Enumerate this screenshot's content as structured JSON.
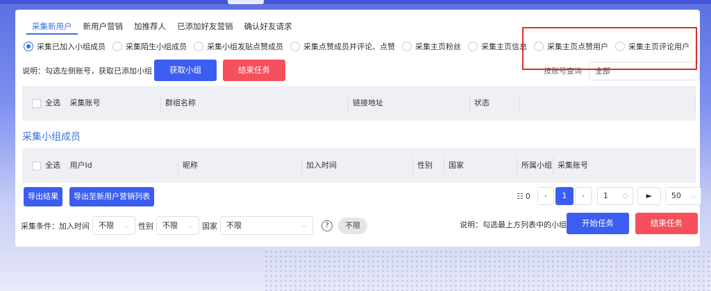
{
  "tabs": [
    "采集新用户",
    "新用户营销",
    "加推荐人",
    "已添加好友营销",
    "确认好友请求"
  ],
  "radio_options": [
    "采集已加入小组成员",
    "采集陌生小组成员",
    "采集小组发贴点赞成员",
    "采集点赞成员并评论、点赞",
    "采集主页粉丝",
    "采集主页信息",
    "采集主页点赞用户",
    "采集主页评论用户"
  ],
  "selected_radio": "采集已加入小组成员",
  "note_top": "说明：勾选左侧账号，获取已添加小组",
  "get_group_label": "获取小组",
  "end_task_top_label": "结束任务",
  "account_query_label": "按账号查询",
  "account_select_value": "全部",
  "table1": {
    "select_all": "全选",
    "columns": [
      "采集账号",
      "群组名称",
      "链接地址",
      "状态"
    ]
  },
  "section_title": "采集小组成员",
  "table2": {
    "select_all": "全选",
    "columns": [
      "用户Id",
      "昵称",
      "加入时间",
      "性别",
      "国家",
      "所属小组",
      "采集账号"
    ]
  },
  "export_label": "导出结果",
  "export_to_list_label": "导出至新用户营销列表",
  "pagination": {
    "total_icon": "list-icon",
    "total": "0",
    "current_page": "1",
    "jump_page": "1",
    "go_symbol": "►",
    "page_size": "50"
  },
  "filters": {
    "label": "采集条件：",
    "join_time_label": "加入时间",
    "join_time_value": "不限",
    "gender_label": "性别",
    "gender_value": "不限",
    "country_label": "国家",
    "country_value": "不限",
    "unlimited_pill": "不限"
  },
  "note_bottom": "说明：勾选最上方列表中的小组",
  "start_task_label": "开始任务",
  "end_task_bottom_label": "结束任务",
  "colors": {
    "accent": "#3a6fe0",
    "primary_button": "#3b5ef0",
    "danger_button": "#f5505c",
    "highlight_box": "#e02a2a"
  }
}
